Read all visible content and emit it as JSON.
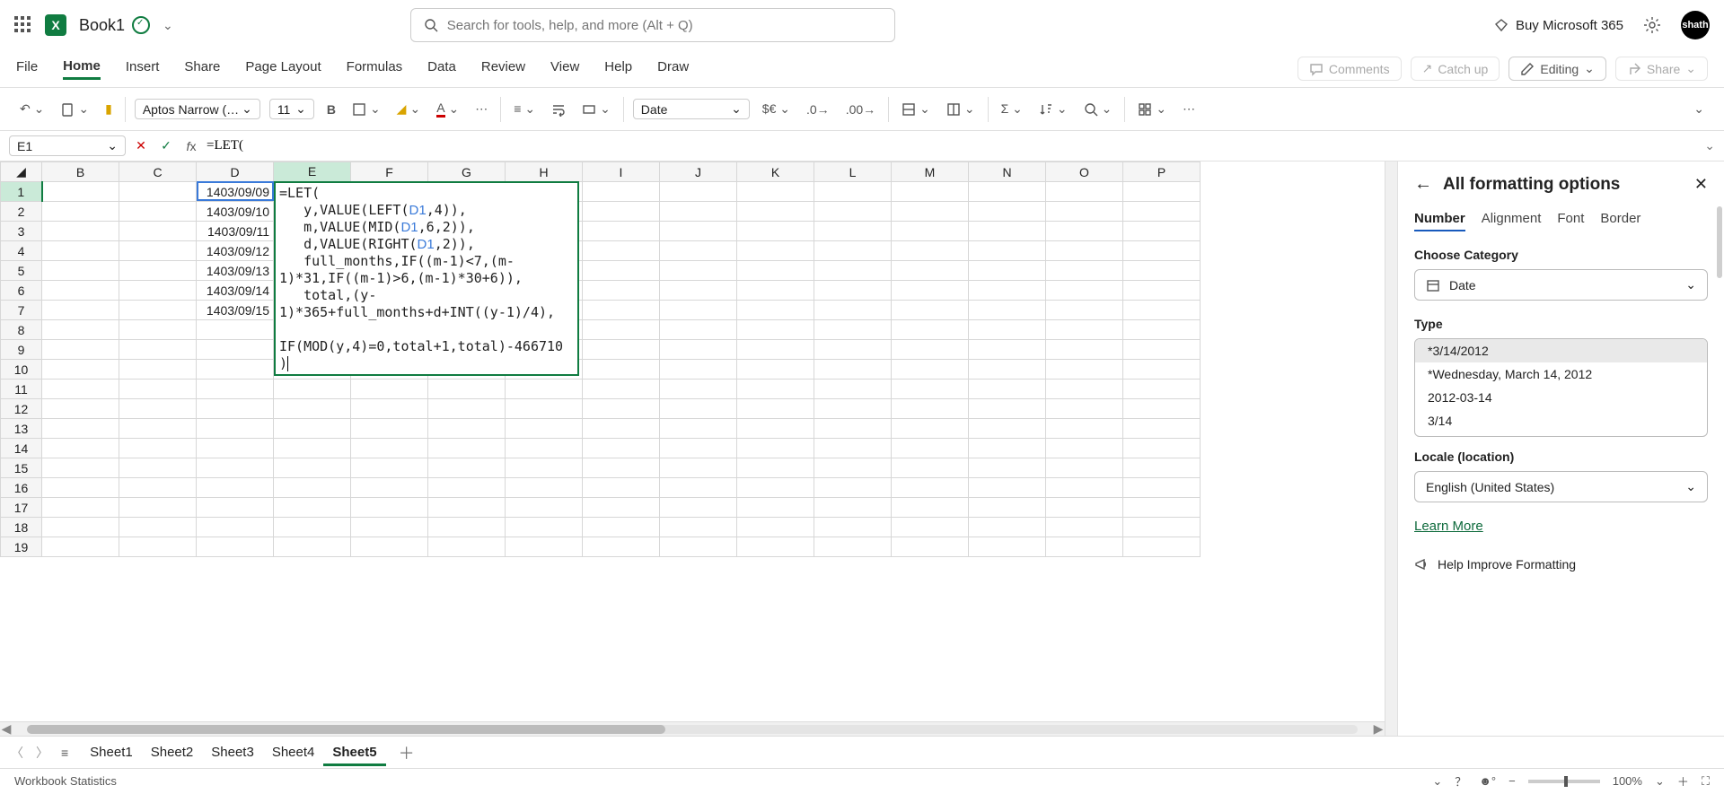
{
  "titlebar": {
    "doc_name": "Book1",
    "search_placeholder": "Search for tools, help, and more (Alt + Q)",
    "buy_label": "Buy Microsoft 365",
    "avatar": "shath"
  },
  "ribbon": {
    "tabs": [
      "File",
      "Home",
      "Insert",
      "Share",
      "Page Layout",
      "Formulas",
      "Data",
      "Review",
      "View",
      "Help",
      "Draw"
    ],
    "active_tab": "Home",
    "comments_label": "Comments",
    "catchup_label": "Catch up",
    "editing_label": "Editing",
    "share_label": "Share",
    "font_name": "Aptos Narrow (…",
    "font_size": "11",
    "number_format": "Date"
  },
  "formula_bar": {
    "name_box": "E1",
    "formula_text": "=LET(",
    "overlay_lines": [
      "=LET(",
      "   y,VALUE(LEFT(D1,4)),",
      "   m,VALUE(MID(D1,6,2)),",
      "   d,VALUE(RIGHT(D1,2)),",
      "   full_months,IF((m-1)<7,(m-1)*31,IF((m-1)>6,(m-1)*30+6)),",
      "   total,(y-1)*365+full_months+d+INT((y-1)/4),",
      "",
      "IF(MOD(y,4)=0,total+1,total)-466710",
      ")"
    ]
  },
  "grid": {
    "columns": [
      "B",
      "C",
      "D",
      "E",
      "F",
      "G",
      "H",
      "I",
      "J",
      "K",
      "L",
      "M",
      "N",
      "O",
      "P"
    ],
    "active_col": "E",
    "rows": [
      1,
      2,
      3,
      4,
      5,
      6,
      7,
      8,
      9,
      10,
      11,
      12,
      13,
      14,
      15,
      16,
      17,
      18,
      19
    ],
    "active_row": 1,
    "d_values": [
      "1403/09/09",
      "1403/09/10",
      "1403/09/11",
      "1403/09/12",
      "1403/09/13",
      "1403/09/14",
      "1403/09/15"
    ]
  },
  "sidepanel": {
    "title": "All formatting options",
    "tabs": [
      "Number",
      "Alignment",
      "Font",
      "Border"
    ],
    "active_tab": "Number",
    "category_label": "Choose Category",
    "category_value": "Date",
    "type_label": "Type",
    "type_options": [
      "*3/14/2012",
      "*Wednesday, March 14, 2012",
      "2012-03-14",
      "3/14"
    ],
    "type_selected": "*3/14/2012",
    "locale_label": "Locale (location)",
    "locale_value": "English (United States)",
    "learn_more": "Learn More",
    "help_label": "Help Improve Formatting"
  },
  "sheet_tabs": {
    "tabs": [
      "Sheet1",
      "Sheet2",
      "Sheet3",
      "Sheet4",
      "Sheet5"
    ],
    "active": "Sheet5"
  },
  "statusbar": {
    "left": "Workbook Statistics",
    "zoom": "100%"
  }
}
